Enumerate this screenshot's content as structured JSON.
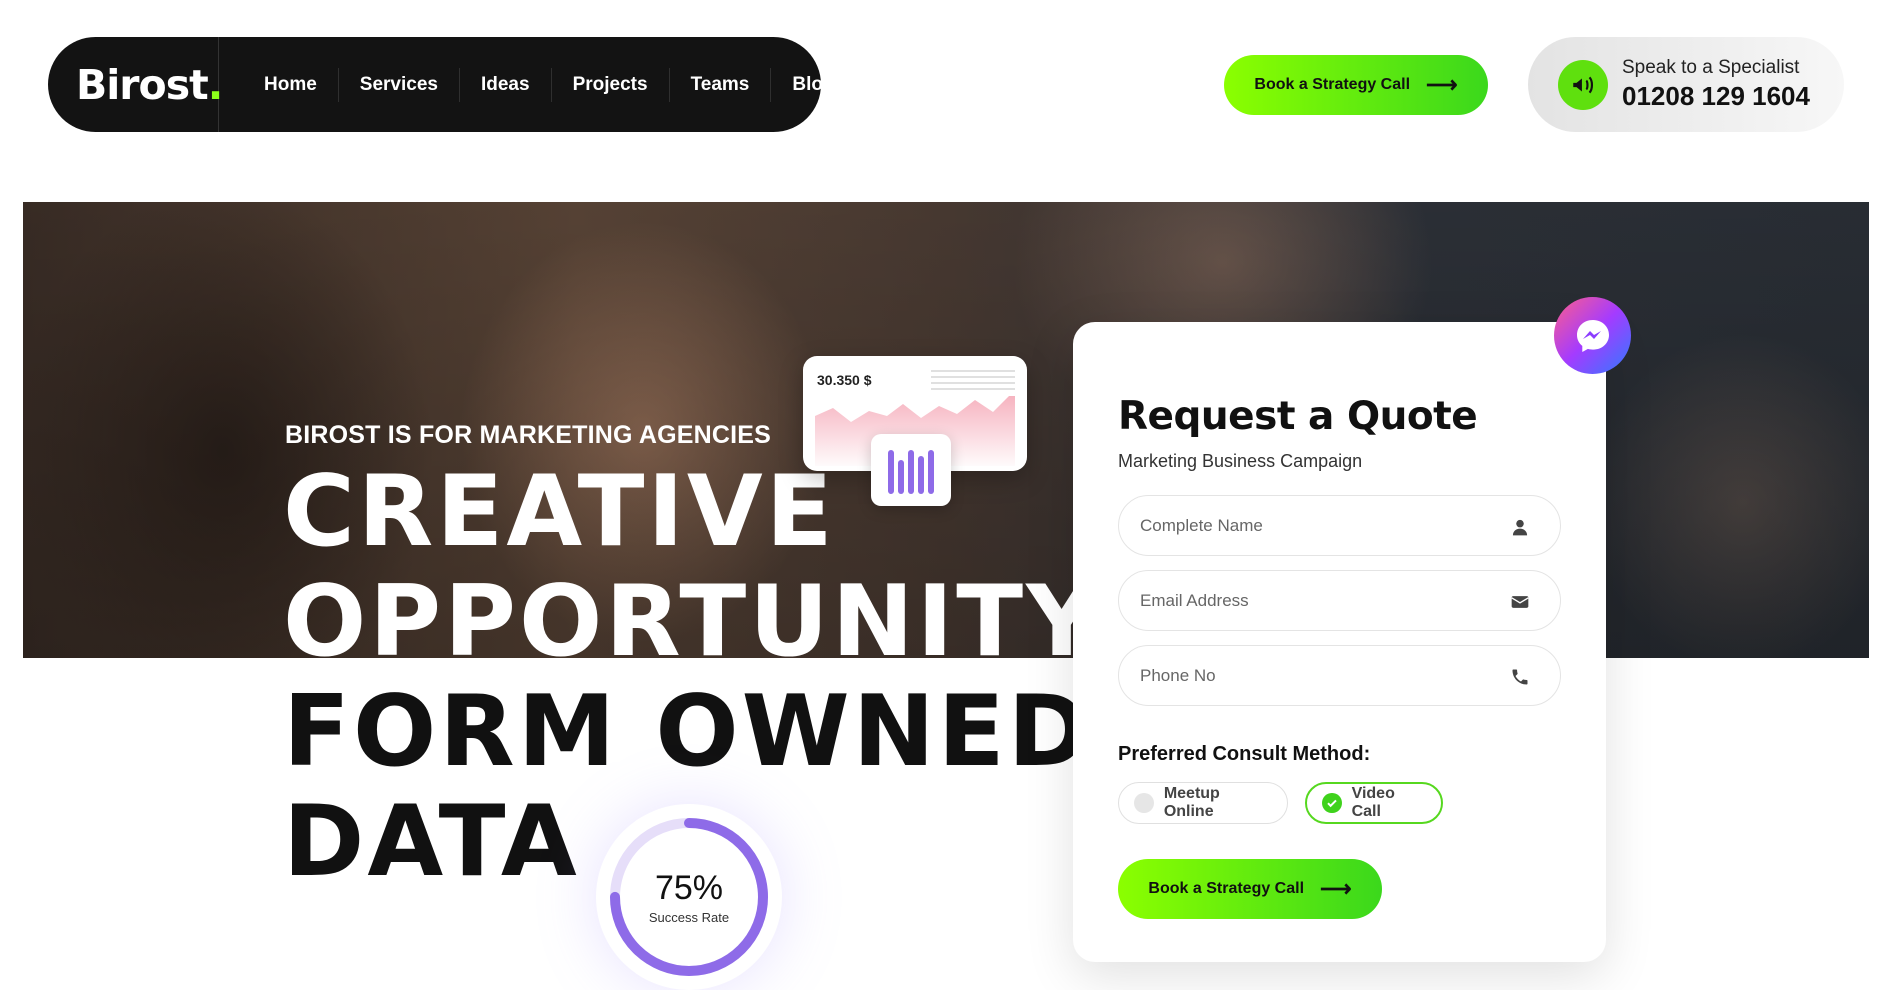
{
  "brand": {
    "name": "Birost",
    "dot": ".",
    "accent": "#8dff1a"
  },
  "nav": {
    "items": [
      "Home",
      "Services",
      "Ideas",
      "Projects",
      "Teams",
      "Blog"
    ]
  },
  "header": {
    "cta_label": "Book a Strategy Call",
    "specialist_label": "Speak to a Specialist",
    "specialist_phone": "01208 129 1604"
  },
  "hero": {
    "eyebrow": "BIROST IS FOR MARKETING AGENCIES",
    "headline": [
      "CREATIVE",
      "OPPORTUNITY",
      "FORM OWNED",
      "DATA"
    ]
  },
  "stat_card": {
    "value": "30.350  $"
  },
  "quote_form": {
    "title": "Request a Quote",
    "subtitle": "Marketing Business Campaign",
    "fields": [
      {
        "placeholder": "Complete Name",
        "icon": "user-icon"
      },
      {
        "placeholder": "Email Address",
        "icon": "envelope-icon"
      },
      {
        "placeholder": "Phone No",
        "icon": "phone-icon"
      }
    ],
    "method_label": "Preferred Consult Method:",
    "methods": [
      {
        "label": "Meetup Online",
        "selected": false
      },
      {
        "label": "Video Call",
        "selected": true
      }
    ],
    "cta_label": "Book a Strategy Call"
  },
  "success": {
    "value": "75%",
    "label": "Success Rate",
    "percent": 75
  },
  "colors": {
    "green": "#56d81f",
    "purple": "#8e6be8",
    "dark": "#131313"
  },
  "icons": {
    "messenger": "messenger-icon",
    "arrow": "arrow-right-icon"
  }
}
